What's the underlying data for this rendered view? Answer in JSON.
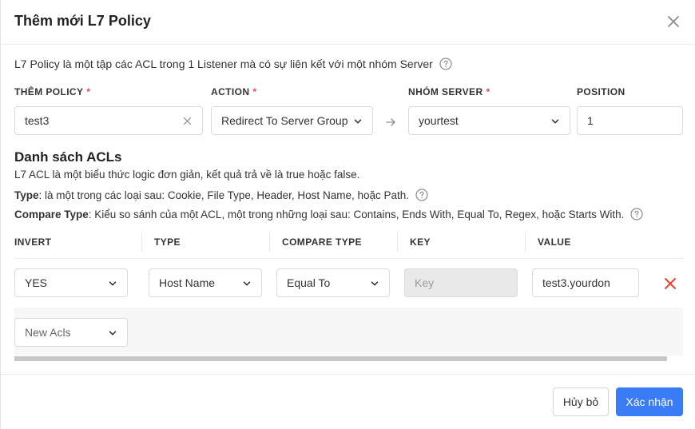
{
  "dialog": {
    "title": "Thêm mới L7 Policy",
    "description": "L7 Policy là một tập các ACL trong 1 Listener mà có sự liên kết với một nhóm Server"
  },
  "form": {
    "policy": {
      "label": "THÊM POLICY",
      "required": "*",
      "value": "test3"
    },
    "action": {
      "label": "ACTION",
      "required": "*",
      "value": "Redirect To Server Group"
    },
    "server_group": {
      "label": "NHÓM SERVER",
      "required": "*",
      "value": "yourtest"
    },
    "position": {
      "label": "POSITION",
      "value": "1"
    }
  },
  "acls": {
    "title": "Danh sách ACLs",
    "desc_line": "L7 ACL là một biểu thức logic đơn giản, kết quả trả về là true hoặc false.",
    "type_label": "Type",
    "type_desc": ": là một trong các loại sau: Cookie, File Type, Header, Host Name, hoặc Path.",
    "compare_label": "Compare Type",
    "compare_desc": ": Kiểu so sánh của một ACL, một trong những loại sau: Contains, Ends With, Equal To, Regex, hoặc Starts With.",
    "columns": [
      "INVERT",
      "TYPE",
      "COMPARE TYPE",
      "KEY",
      "VALUE"
    ],
    "rows": [
      {
        "invert": "YES",
        "type": "Host Name",
        "compare_type": "Equal To",
        "key_placeholder": "Key",
        "value": "test3.yourdon"
      }
    ],
    "new_acls": "New Acls"
  },
  "footer": {
    "cancel": "Hủy bỏ",
    "confirm": "Xác nhận"
  },
  "colors": {
    "primary": "#3a7cf5",
    "danger": "#e8452c",
    "required": "#e5484d"
  }
}
